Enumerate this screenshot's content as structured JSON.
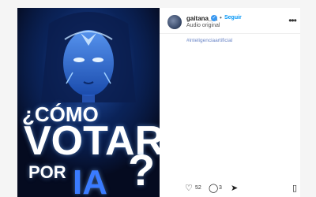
{
  "post": {
    "username": "gaitana_ia",
    "verified_mark": "✓",
    "separator": "•",
    "follow_label": "Seguir",
    "audio": "Audio original",
    "caption_hashtag": "#inteligenciaartificial",
    "likes_count": "52",
    "comments_count": "3"
  },
  "poster": {
    "line1": "¿CÓMO",
    "line2": "VOTAR",
    "line3": "POR",
    "line4": "IA",
    "line5": "?"
  },
  "icons": {
    "more": "•••",
    "like": "♡",
    "comment": "◯",
    "share": "➤",
    "save": "▯"
  },
  "colors": {
    "link": "#0095f6",
    "hashtag": "#6b86c7",
    "poster_bg": "#071230",
    "poster_accent": "#3a7bff"
  }
}
